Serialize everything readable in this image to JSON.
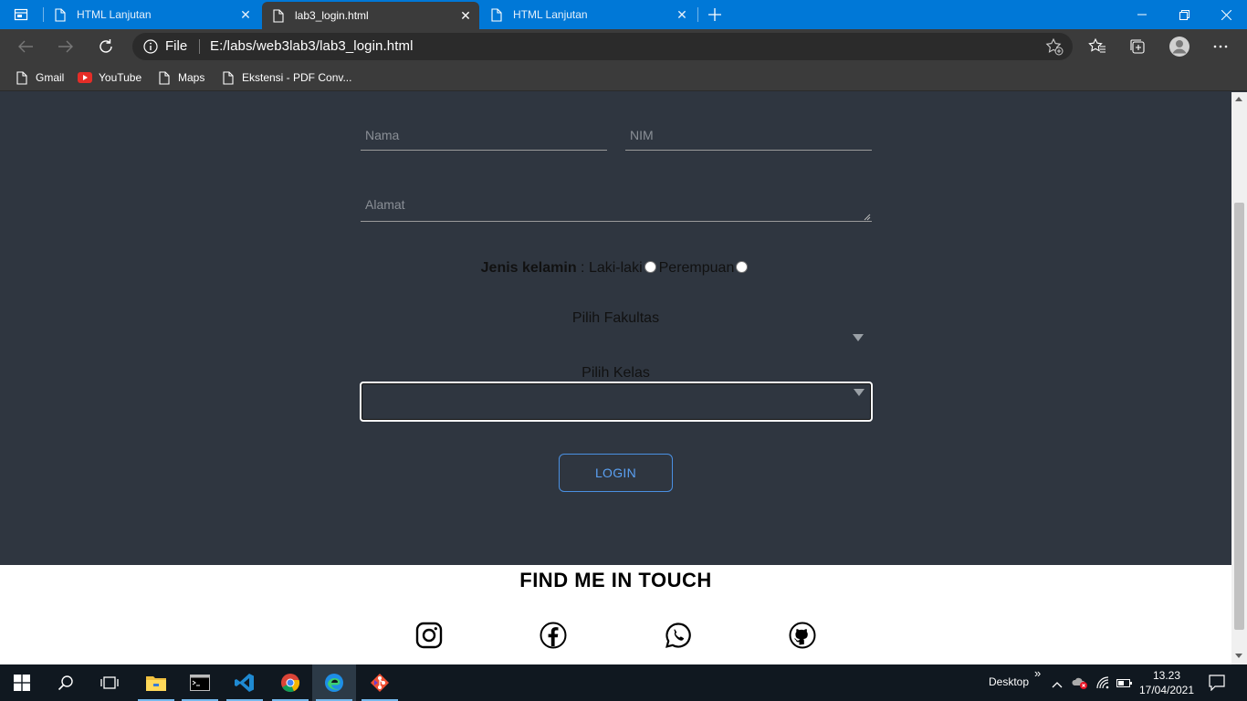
{
  "browser": {
    "tabs": [
      {
        "label": "HTML Lanjutan",
        "active": false
      },
      {
        "label": "lab3_login.html",
        "active": true
      },
      {
        "label": "HTML Lanjutan",
        "active": false
      }
    ],
    "address": {
      "scheme_label": "File",
      "url": "E:/labs/web3lab3/lab3_login.html"
    },
    "bookmarks": [
      {
        "label": "Gmail",
        "icon": "page-icon"
      },
      {
        "label": "YouTube",
        "icon": "youtube-icon"
      },
      {
        "label": "Maps",
        "icon": "page-icon"
      },
      {
        "label": "Ekstensi - PDF Conv...",
        "icon": "page-icon"
      }
    ],
    "accent_color": "#0078d7"
  },
  "form": {
    "nama_placeholder": "Nama",
    "nim_placeholder": "NIM",
    "alamat_placeholder": "Alamat",
    "gender_label": "Jenis kelamin",
    "gender_separator": " : ",
    "gender_options": [
      "Laki-laki",
      "Perempuan"
    ],
    "fakultas_label": "Pilih Fakultas",
    "fakultas_value": "",
    "kelas_label": "Pilih Kelas",
    "kelas_value": "",
    "login_label": "LOGIN",
    "background_color": "#2f3640",
    "button_color": "#4a90e2"
  },
  "footer": {
    "title": "FIND ME IN TOUCH",
    "social": [
      "instagram-icon",
      "facebook-icon",
      "whatsapp-icon",
      "github-icon"
    ]
  },
  "taskbar": {
    "desktop_label": "Desktop",
    "overflow_label": "»",
    "time": "13.23",
    "date": "17/04/2021"
  }
}
